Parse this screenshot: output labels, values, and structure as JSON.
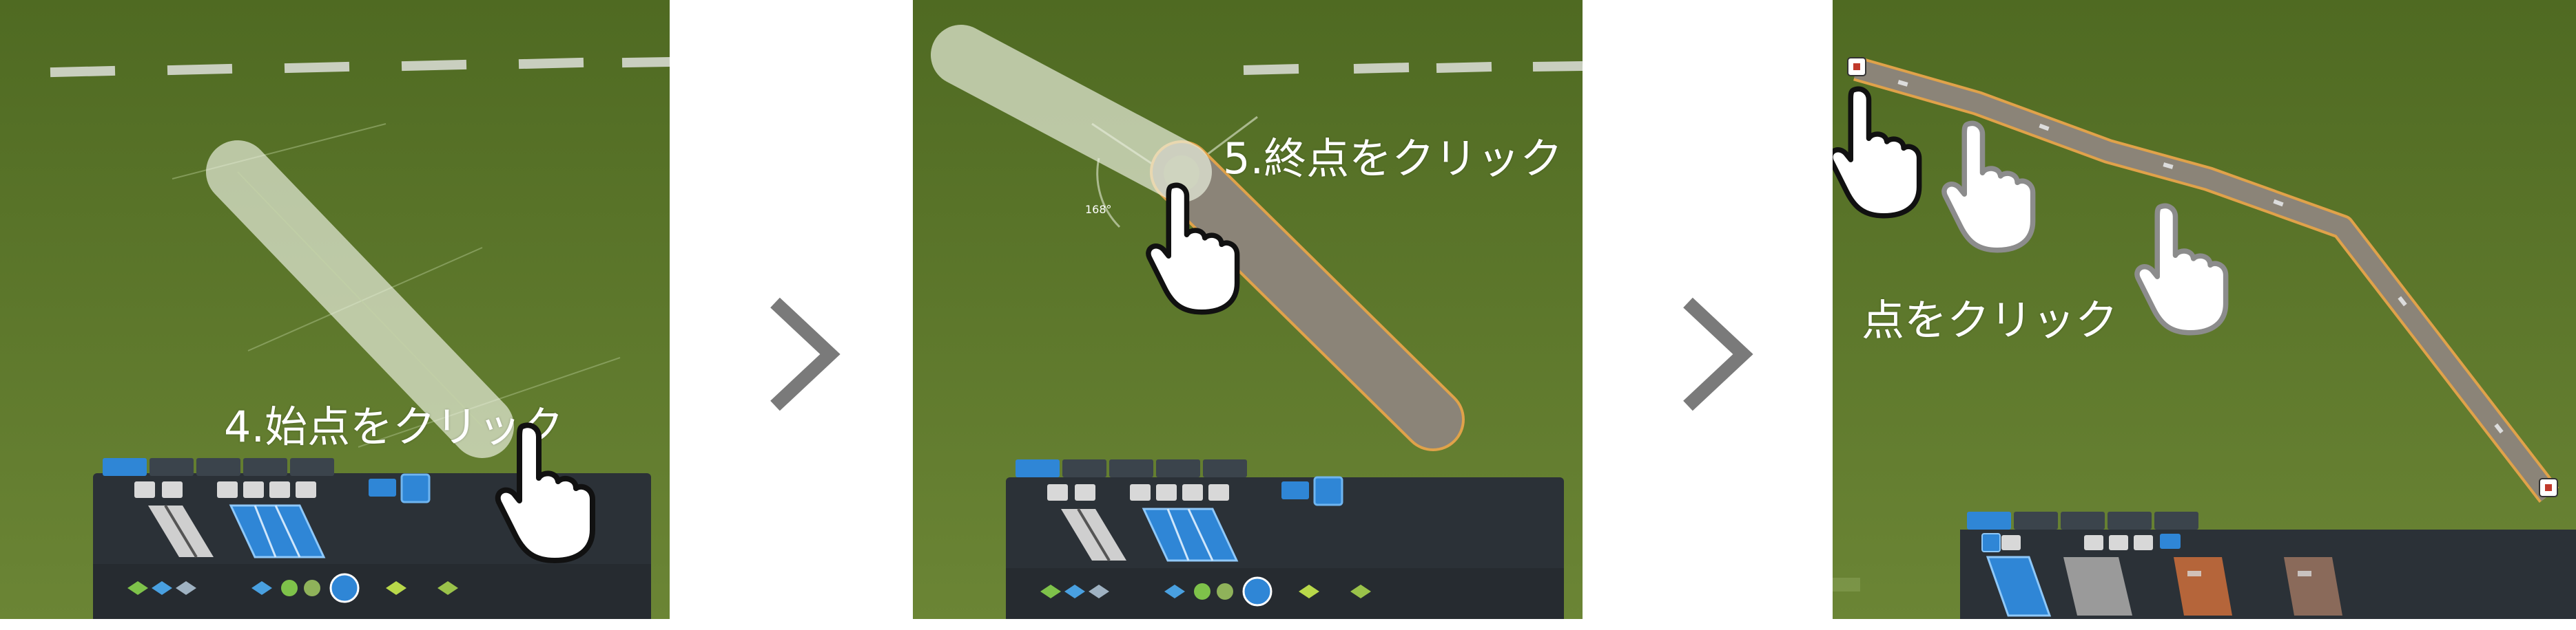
{
  "steps": [
    {
      "caption": "4.始点をクリック"
    },
    {
      "caption": "5.終点をクリック",
      "angle_label": "168°"
    },
    {
      "caption": "点をクリック"
    }
  ],
  "icons": {
    "next_arrow": "chevron-right-icon",
    "pointer": "hand-pointer-icon",
    "endpoint_marker": "marker-icon"
  },
  "colors": {
    "grass": "#5f7a2c",
    "toolbar": "#2b3137",
    "tab_active": "#2f86d6",
    "road_preview": "#d9e4c4",
    "road_asphalt": "#8b8478",
    "road_outline": "#e0a24a",
    "chevron": "#7a7a7a"
  }
}
